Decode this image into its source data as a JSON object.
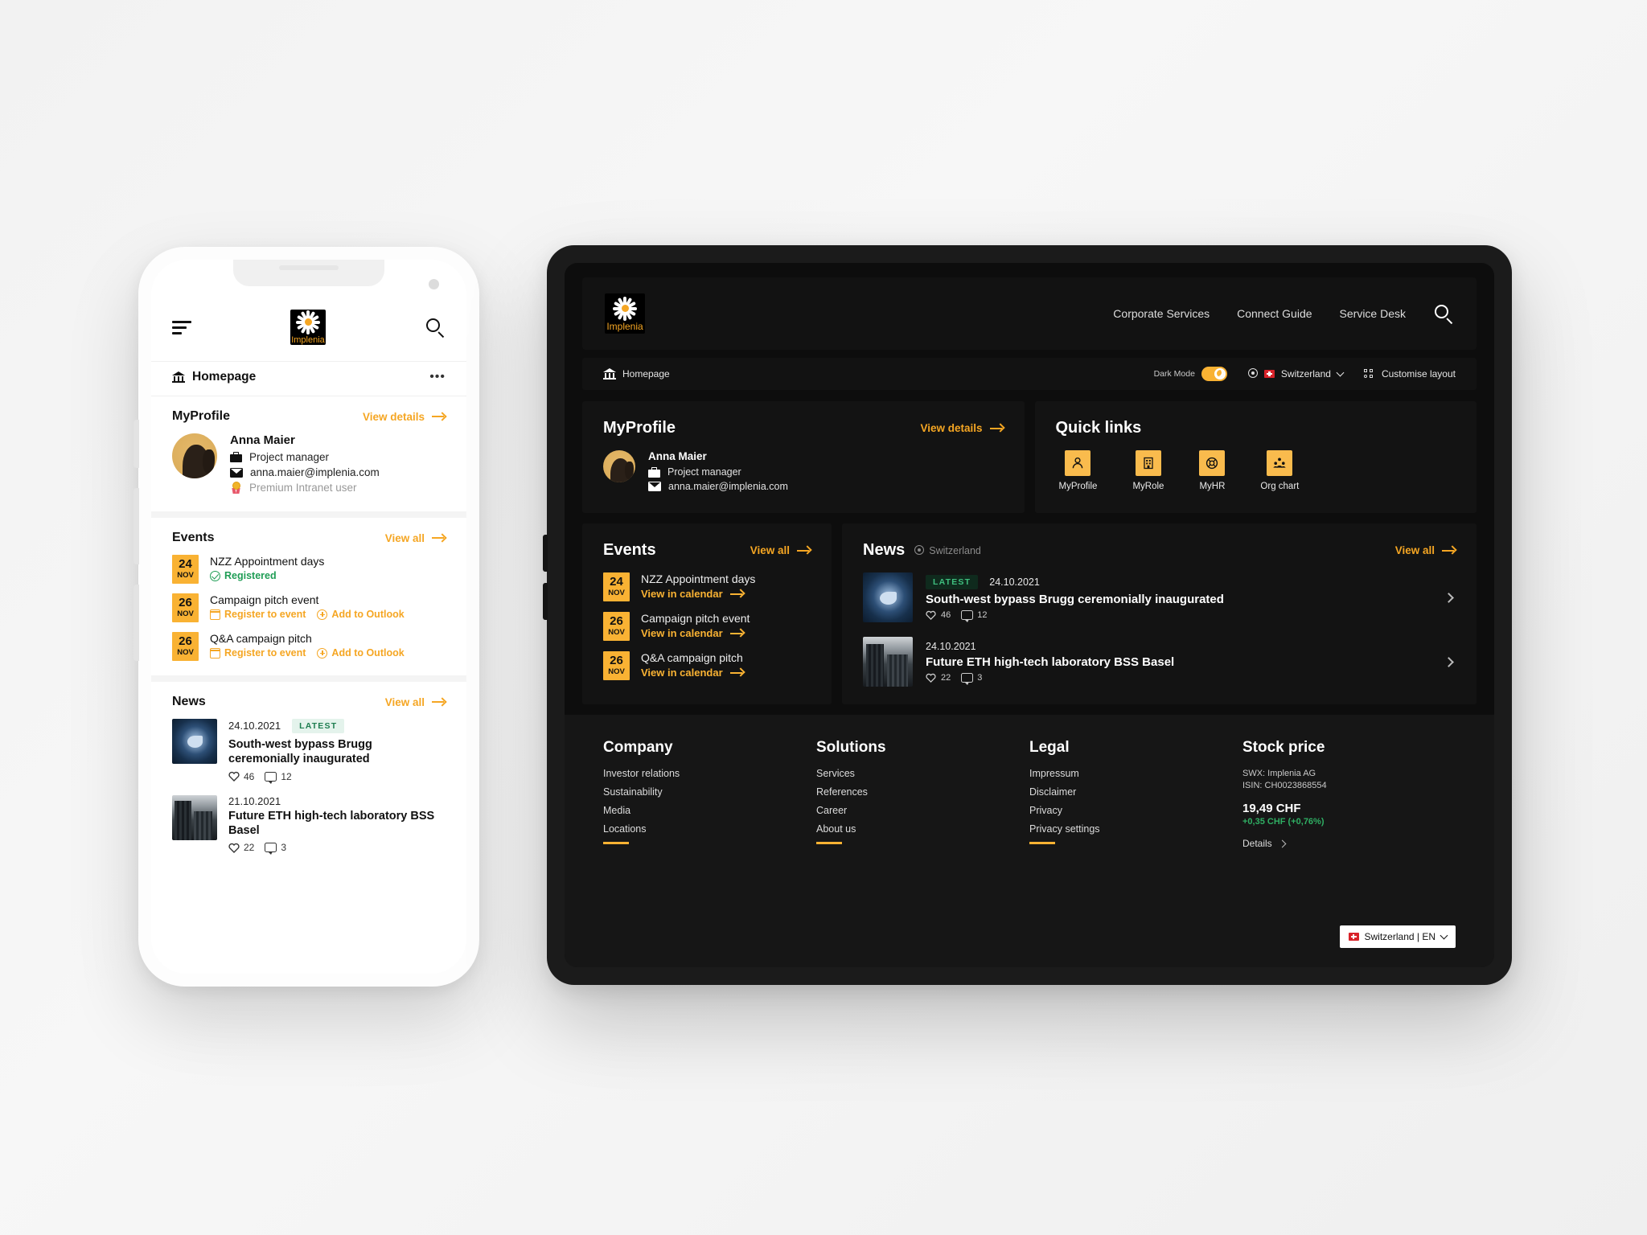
{
  "brand": {
    "name": "Implenia",
    "accent": "#f9b233",
    "dark_bg": "#0d0d0d"
  },
  "phone": {
    "breadcrumb": "Homepage",
    "more_label": "•••",
    "profile": {
      "title": "MyProfile",
      "view_details": "View details",
      "name": "Anna Maier",
      "role": "Project manager",
      "email": "anna.maier@implenia.com",
      "tier": "Premium Intranet user"
    },
    "events": {
      "title": "Events",
      "view_all": "View all",
      "items": [
        {
          "day": "24",
          "month": "NOV",
          "title": "NZZ Appointment days",
          "status": "Registered",
          "actions": []
        },
        {
          "day": "26",
          "month": "NOV",
          "title": "Campaign pitch event",
          "status": "",
          "actions": [
            "Register to event",
            "Add to Outlook"
          ]
        },
        {
          "day": "26",
          "month": "NOV",
          "title": "Q&A campaign pitch",
          "status": "",
          "actions": [
            "Register to event",
            "Add to Outlook"
          ]
        }
      ]
    },
    "news": {
      "title": "News",
      "view_all": "View all",
      "latest_badge": "LATEST",
      "items": [
        {
          "date": "24.10.2021",
          "title": "South-west bypass Brugg ceremonially inaugurated",
          "likes": "46",
          "comments": "12",
          "latest": true
        },
        {
          "date": "21.10.2021",
          "title": "Future ETH high-tech laboratory BSS Basel",
          "likes": "22",
          "comments": "3",
          "latest": false
        }
      ]
    }
  },
  "tablet": {
    "nav": [
      "Corporate Services",
      "Connect Guide",
      "Service Desk"
    ],
    "toolbar": {
      "breadcrumb": "Homepage",
      "dark_mode_label": "Dark Mode",
      "country": "Switzerland",
      "customise": "Customise layout"
    },
    "profile": {
      "title": "MyProfile",
      "view_details": "View details",
      "name": "Anna Maier",
      "role": "Project manager",
      "email": "anna.maier@implenia.com"
    },
    "quick_links": {
      "title": "Quick links",
      "items": [
        {
          "label": "MyProfile",
          "icon": "person-icon"
        },
        {
          "label": "MyRole",
          "icon": "building-icon"
        },
        {
          "label": "MyHR",
          "icon": "lifebuoy-icon"
        },
        {
          "label": "Org chart",
          "icon": "org-chart-icon"
        }
      ]
    },
    "events": {
      "title": "Events",
      "view_all": "View all",
      "action_label": "View in calendar",
      "items": [
        {
          "day": "24",
          "month": "NOV",
          "title": "NZZ Appointment days"
        },
        {
          "day": "26",
          "month": "NOV",
          "title": "Campaign pitch event"
        },
        {
          "day": "26",
          "month": "NOV",
          "title": "Q&A campaign pitch"
        }
      ]
    },
    "news": {
      "title": "News",
      "location": "Switzerland",
      "view_all": "View all",
      "latest_badge": "LATEST",
      "items": [
        {
          "date": "24.10.2021",
          "title": "South-west bypass Brugg ceremonially inaugurated",
          "likes": "46",
          "comments": "12",
          "latest": true
        },
        {
          "date": "24.10.2021",
          "title": "Future ETH high-tech laboratory BSS Basel",
          "likes": "22",
          "comments": "3",
          "latest": false
        }
      ]
    },
    "footer": {
      "columns": [
        {
          "heading": "Company",
          "links": [
            "Investor relations",
            "Sustainability",
            "Media",
            "Locations"
          ]
        },
        {
          "heading": "Solutions",
          "links": [
            "Services",
            "References",
            "Career",
            "About us"
          ]
        },
        {
          "heading": "Legal",
          "links": [
            "Impressum",
            "Disclaimer",
            "Privacy",
            "Privacy settings"
          ]
        }
      ],
      "stock": {
        "heading": "Stock price",
        "exchange": "SWX: Implenia AG",
        "isin": "ISIN: CH0023868554",
        "price": "19,49 CHF",
        "change": "+0,35 CHF (+0,76%)",
        "details": "Details"
      },
      "language": "Switzerland | EN"
    }
  }
}
